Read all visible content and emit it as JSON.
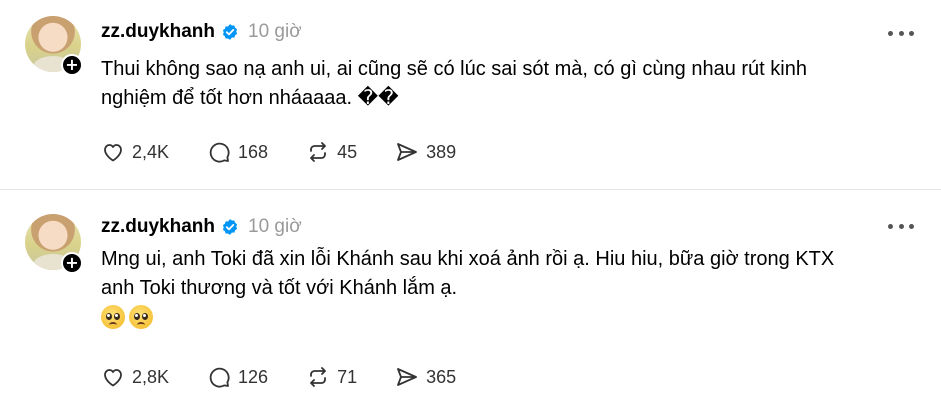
{
  "posts": [
    {
      "username": "zz.duykhanh",
      "time": "10 giờ",
      "follow_symbol": "+",
      "text_lines": [
        "Thui không sao nạ anh ui, ai cũng sẽ có lúc sai sót mà, có gì cùng nhau rút kinh",
        "nghiệm để tốt hơn nháaaaa. ��"
      ],
      "emojis": [],
      "actions": {
        "likes": "2,4K",
        "replies": "168",
        "reposts": "45",
        "shares": "389"
      }
    },
    {
      "username": "zz.duykhanh",
      "time": "10 giờ",
      "follow_symbol": "+",
      "text_lines": [
        "Mng ui, anh Toki đã xin lỗi Khánh sau khi xoá ảnh rồi ạ. Hiu hiu, bữa giờ trong KTX",
        "anh Toki thương và tốt với Khánh lắm ạ."
      ],
      "emojis": [
        "pleading-face-icon",
        "pleading-face-icon"
      ],
      "actions": {
        "likes": "2,8K",
        "replies": "126",
        "reposts": "71",
        "shares": "365"
      }
    }
  ],
  "colors": {
    "text": "#000000",
    "muted": "#9a9a9a",
    "verified": "#0095f6",
    "divider": "#e4e4e4"
  }
}
